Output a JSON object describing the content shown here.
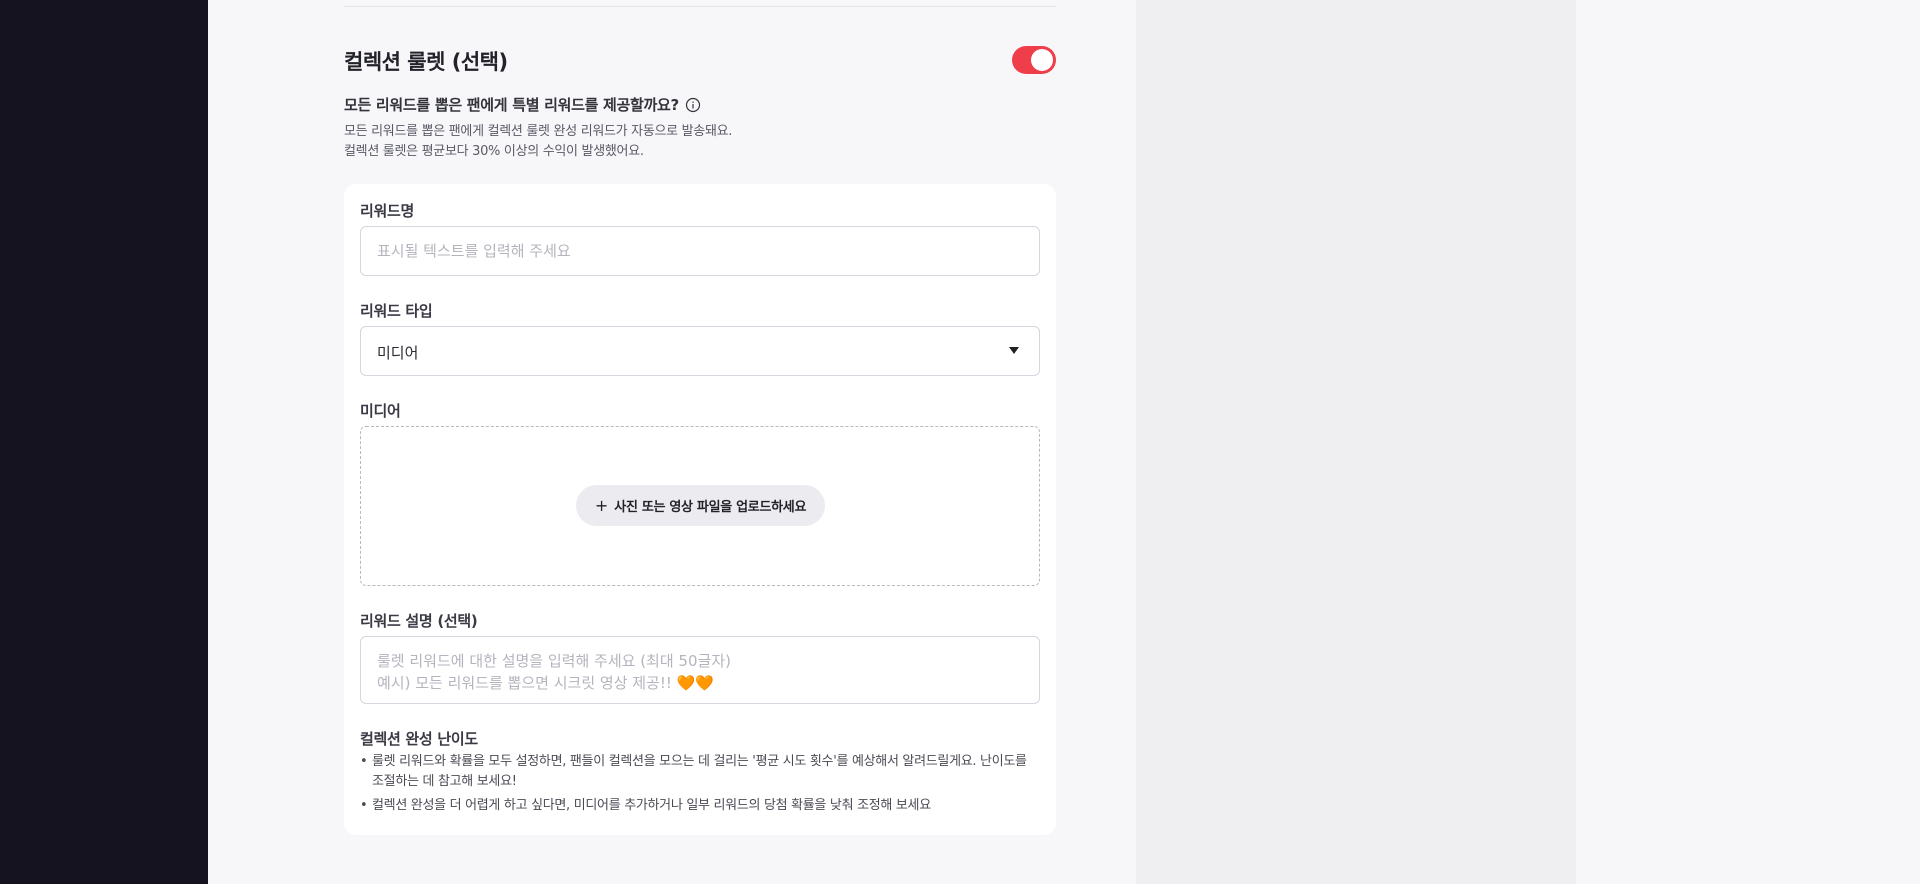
{
  "section": {
    "title": "컬렉션 룰렛 (선택)",
    "toggle_on": true,
    "question": "모든 리워드를 뽑은 팬에게 특별 리워드를 제공할까요?",
    "desc_line1": "모든 리워드를 뽑은 팬에게 컬렉션 룰렛 완성 리워드가 자동으로 발송돼요.",
    "desc_line2": "컬렉션 룰렛은 평균보다 30% 이상의 수익이 발생했어요."
  },
  "form": {
    "reward_name": {
      "label": "리워드명",
      "placeholder": "표시될 텍스트를 입력해 주세요",
      "value": ""
    },
    "reward_type": {
      "label": "리워드 타입",
      "selected": "미디어"
    },
    "media": {
      "label": "미디어",
      "upload_label": "사진 또는 영상 파일을 업로드하세요"
    },
    "reward_desc": {
      "label": "리워드 설명 (선택)",
      "placeholder": "룰렛 리워드에 대한 설명을 입력해 주세요 (최대 50글자)\n예시) 모든 리워드를 뽑으면 시크릿 영상 제공!! 🧡🧡"
    },
    "difficulty": {
      "label": "컬렉션 완성 난이도",
      "items": [
        "룰렛 리워드와 확률을 모두 설정하면, 팬들이 컬렉션을 모으는 데 걸리는 '평균 시도 횟수'를 예상해서 알려드릴게요. 난이도를 조절하는 데 참고해 보세요!",
        "컬렉션 완성을 더 어렵게 하고 싶다면, 미디어를 추가하거나 일부 리워드의 당첨 확률을 낮춰 조정해 보세요"
      ]
    }
  },
  "colors": {
    "accent": "#ef3e4a",
    "sidebar": "#15131f",
    "panel": "#efeff2"
  }
}
